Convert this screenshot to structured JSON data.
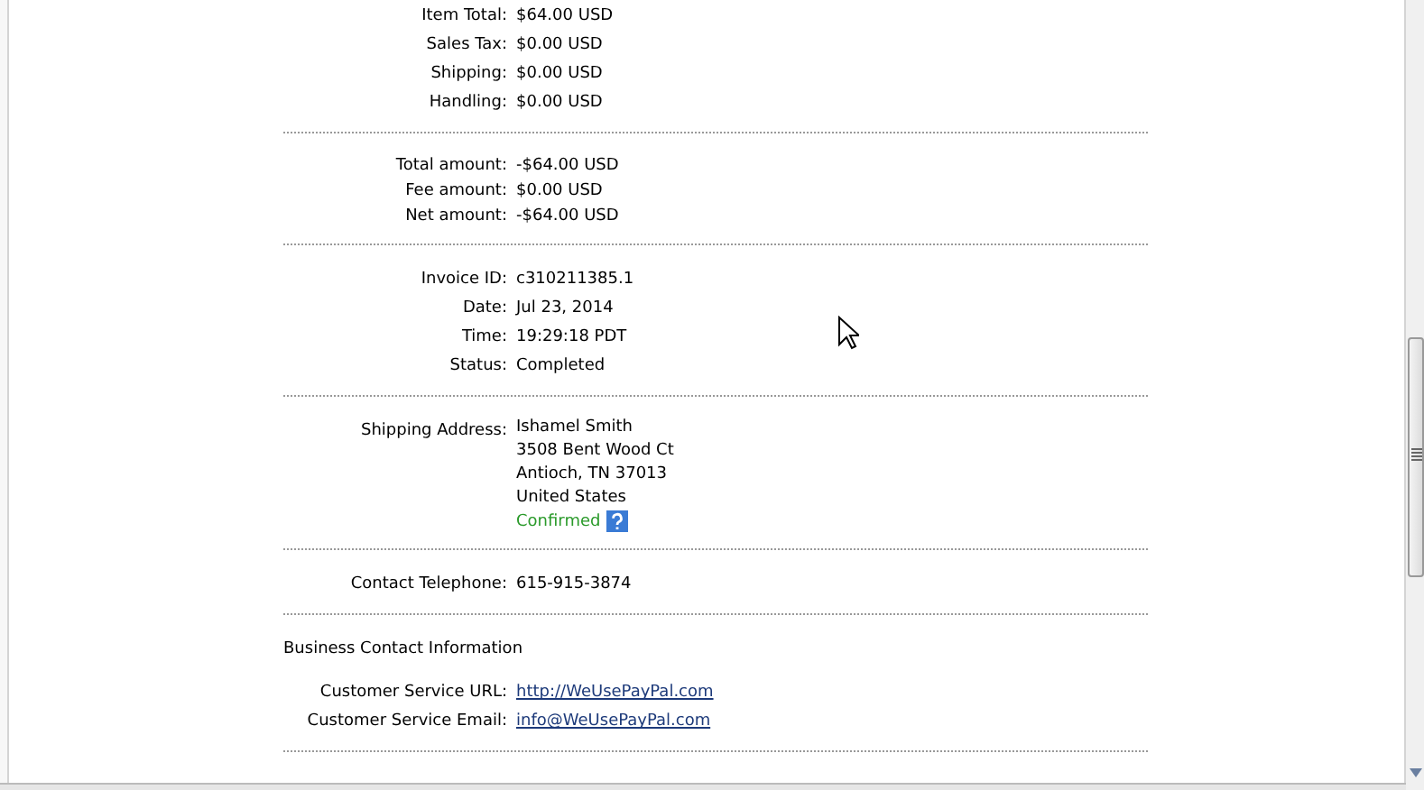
{
  "sections": [
    {
      "rows": [
        {
          "label": "Item Total:",
          "value": "$64.00 USD"
        },
        {
          "label": "Sales Tax:",
          "value": "$0.00 USD"
        },
        {
          "label": "Shipping:",
          "value": "$0.00 USD"
        },
        {
          "label": "Handling:",
          "value": "$0.00 USD"
        }
      ]
    },
    {
      "rows": [
        {
          "label": "Total amount:",
          "value": "-$64.00 USD"
        },
        {
          "label": "Fee amount:",
          "value": "$0.00 USD"
        },
        {
          "label": "Net amount:",
          "value": "-$64.00 USD"
        }
      ]
    },
    {
      "rows": [
        {
          "label": "Invoice ID:",
          "value": "c310211385.1"
        },
        {
          "label": "Date:",
          "value": "Jul 23, 2014"
        },
        {
          "label": "Time:",
          "value": "19:29:18 PDT"
        },
        {
          "label": "Status:",
          "value": "Completed"
        }
      ]
    },
    {
      "rows": [
        {
          "label": "Shipping Address:",
          "lines": [
            "Ishamel Smith",
            "3508 Bent Wood Ct",
            "Antioch, TN 37013",
            "United States"
          ],
          "status": "Confirmed"
        }
      ]
    },
    {
      "rows": [
        {
          "label": "Contact Telephone:",
          "value": "615-915-3874"
        }
      ]
    },
    {
      "heading": "Business Contact Information",
      "rows": [
        {
          "label": "Customer Service URL:",
          "value": "http://WeUsePayPal.com",
          "kind": "link"
        },
        {
          "label": "Customer Service Email:",
          "value": "info@WeUsePayPal.com",
          "kind": "link"
        }
      ]
    }
  ]
}
